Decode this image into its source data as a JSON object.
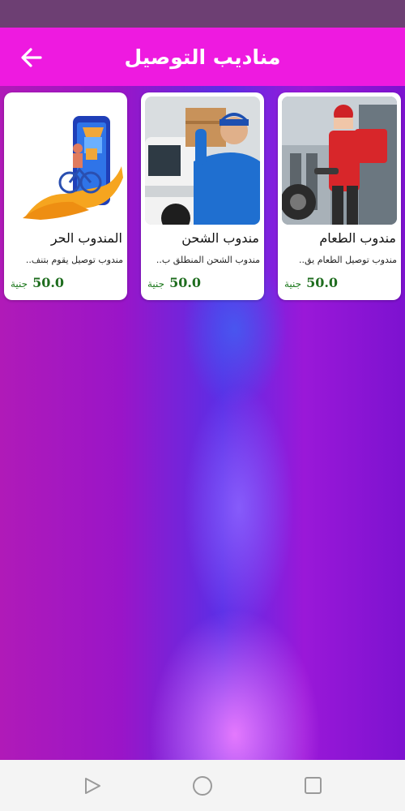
{
  "header": {
    "title": "مناديب التوصيل",
    "back_icon": "arrow-left-icon"
  },
  "colors": {
    "status_bar": "#6d3f73",
    "app_bar": "#ee1ae0",
    "price": "#1f6d1f"
  },
  "cards": [
    {
      "title": "مندوب الطعام",
      "description": "مندوب توصيل الطعام يق..",
      "price": "50.0",
      "currency": "جنية",
      "image": "food-delivery-courier-photo"
    },
    {
      "title": "مندوب الشحن",
      "description": "مندوب الشحن المنطلق ب..",
      "price": "50.0",
      "currency": "جنية",
      "image": "shipping-courier-with-box-photo"
    },
    {
      "title": "المندوب الحر",
      "description": "مندوب توصيل يقوم بتنف..",
      "price": "50.0",
      "currency": "جنية",
      "image": "bike-delivery-illustration"
    }
  ],
  "nav": {
    "back_icon": "triangle-back-icon",
    "home_icon": "circle-home-icon",
    "recents_icon": "square-recents-icon"
  }
}
